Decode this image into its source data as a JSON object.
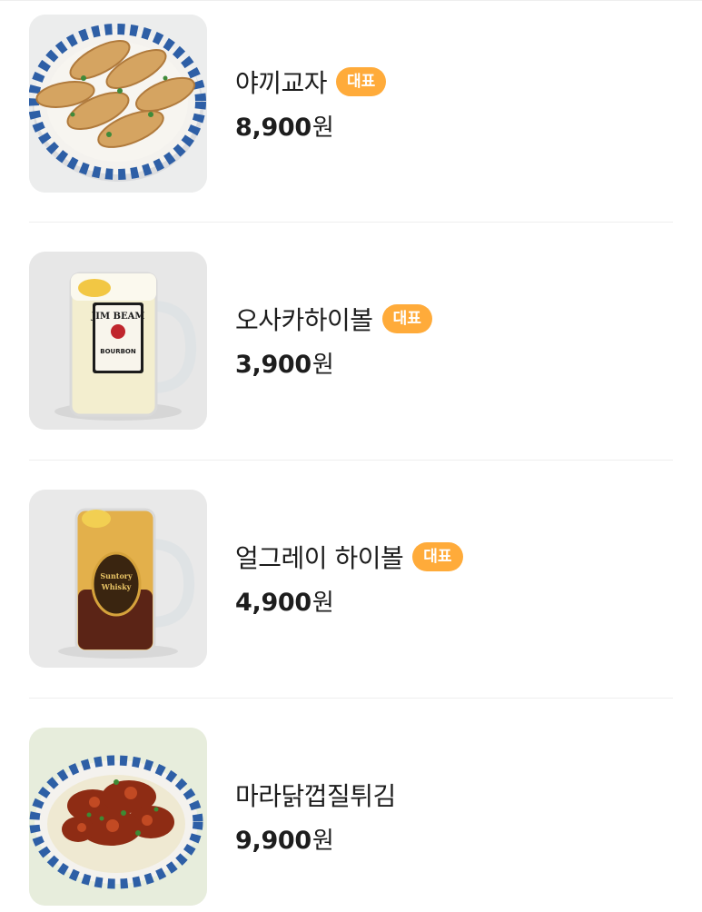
{
  "menu": {
    "currency_label": "원",
    "items": [
      {
        "name": "야끼교자",
        "badge": "대표",
        "price": "8,900",
        "image": "dumplings-plate-image"
      },
      {
        "name": "오사카하이볼",
        "badge": "대표",
        "price": "3,900",
        "image": "highball-mug-image"
      },
      {
        "name": "얼그레이 하이볼",
        "badge": "대표",
        "price": "4,900",
        "image": "earlgrey-highball-mug-image"
      },
      {
        "name": "마라닭껍질튀김",
        "badge": "",
        "price": "9,900",
        "image": "fried-chicken-skin-plate-image"
      }
    ]
  },
  "image_text": {
    "jim_beam_label": "JIM BEAM",
    "jim_beam_sub": "BOURBON",
    "suntory_label": "Suntory",
    "suntory_sub": "Whisky"
  },
  "colors": {
    "badge_background": "#ffab3a",
    "divider": "#eeeeee",
    "text_primary": "#1d1d1d"
  }
}
